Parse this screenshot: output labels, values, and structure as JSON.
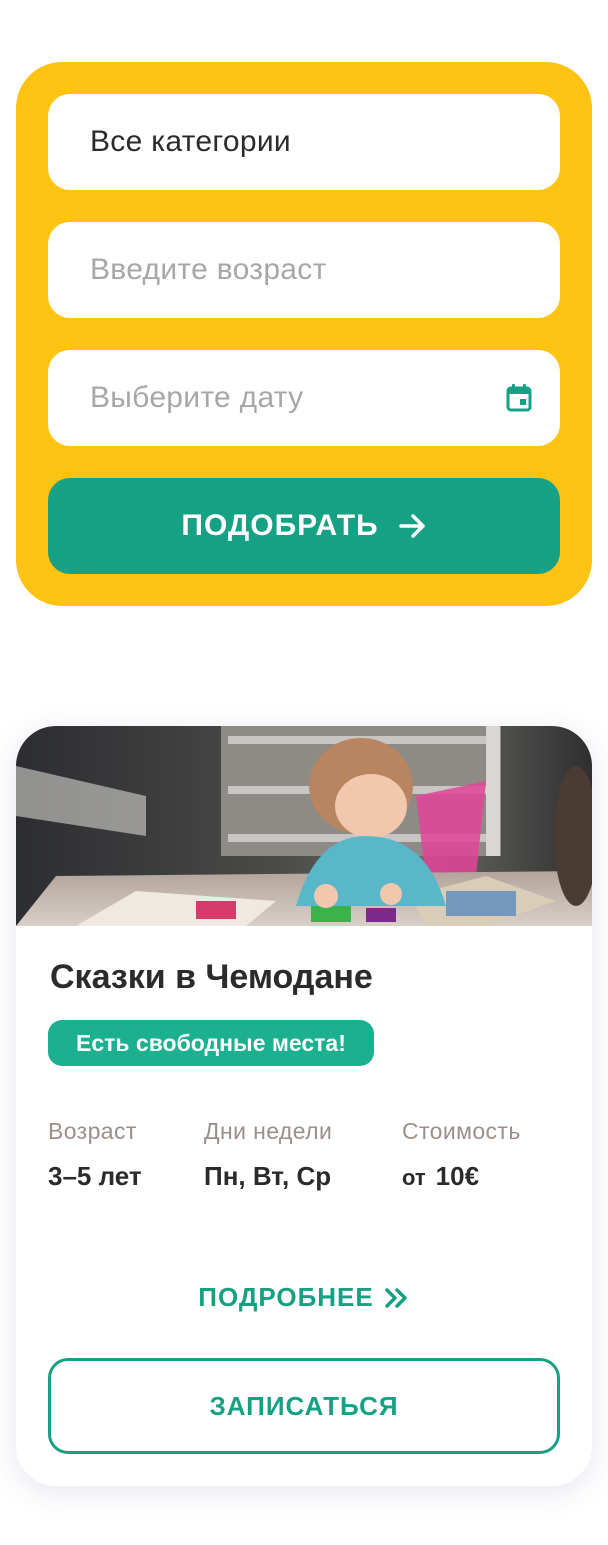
{
  "filters": {
    "category_value": "Все категории",
    "age_placeholder": "Введите возраст",
    "date_placeholder": "Выберите дату",
    "date_icon": "calendar-icon",
    "submit_label": "ПОДОБРАТЬ",
    "submit_icon": "arrow-right-icon"
  },
  "card": {
    "title": "Сказки в Чемодане",
    "badge": "Есть свободные места!",
    "info": {
      "age_label": "Возраст",
      "age_value": "3–5 лет",
      "days_label": "Дни недели",
      "days_value": "Пн, Вт, Ср",
      "price_label": "Стоимость",
      "price_prefix": "от",
      "price_value": "10€"
    },
    "details_label": "ПОДРОБНЕЕ",
    "details_icon": "double-chevron-right-icon",
    "enroll_label": "ЗАПИСАТЬСЯ"
  },
  "colors": {
    "panel": "#FFC314",
    "accent": "#17A184",
    "badge": "#1BB08F"
  }
}
